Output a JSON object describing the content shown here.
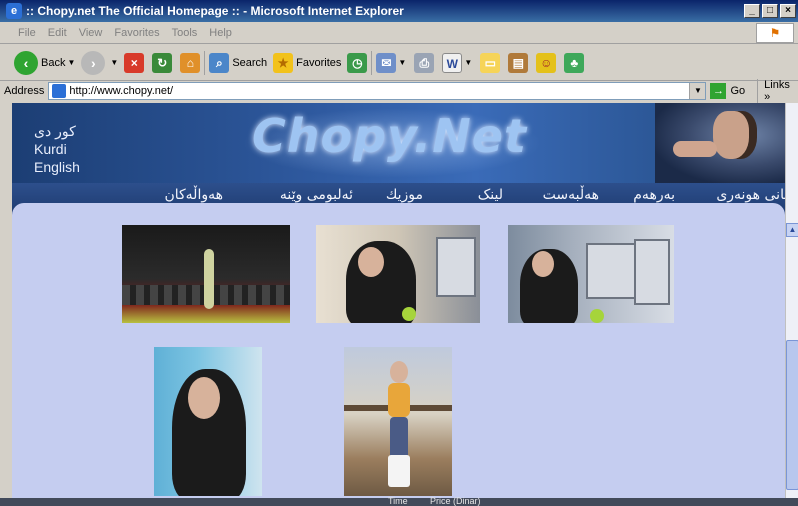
{
  "window": {
    "title": ":: Chopy.net The Official Homepage :: - Microsoft Internet Explorer",
    "controls": [
      "_",
      "□",
      "×"
    ]
  },
  "menubar": {
    "items": [
      "File",
      "Edit",
      "View",
      "Favorites",
      "Tools",
      "Help"
    ]
  },
  "toolbar": {
    "back": "Back",
    "search": "Search",
    "favorites": "Favorites"
  },
  "addressbar": {
    "label": "Address",
    "url": "http://www.chopy.net/",
    "go": "Go",
    "links": "Links"
  },
  "site": {
    "logo": "Chopy.Net",
    "languages": [
      "کور دی",
      "Kurdi",
      "English"
    ],
    "nav": [
      "ژیانی هونەری",
      "بەرهەم",
      "هەڵبەست",
      "لینک",
      "موزیك",
      "ئەلبومی وێنە",
      "هەواڵەکان"
    ]
  },
  "footer": {
    "time": "Time",
    "price": "Price (Dinar)"
  }
}
